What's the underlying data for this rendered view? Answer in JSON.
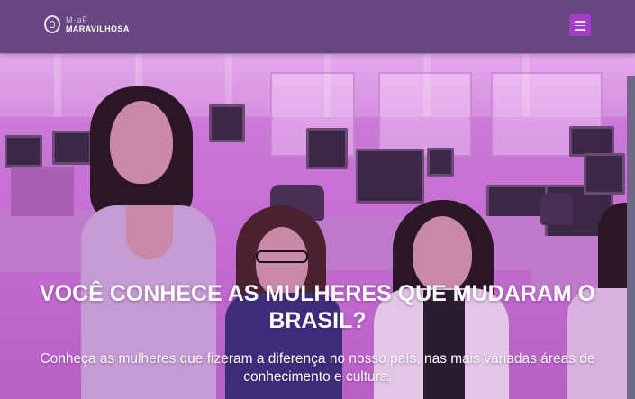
{
  "brand": {
    "line1": "M·ǝF",
    "line2": "MARAVILHOSA"
  },
  "nav": {
    "menu_icon": "hamburger-menu-icon",
    "menu_color": "#a23fc4",
    "bar_color": "#67477f"
  },
  "hero": {
    "title": "VOCÊ CONHECE AS MULHERES QUE MUDARAM O BRASIL?",
    "subtitle": "Conheça as mulheres que fizeram a diferença no nosso país, nas mais variadas áreas de conhecimento e cultura.",
    "overlay_color": "#c36fd0"
  }
}
